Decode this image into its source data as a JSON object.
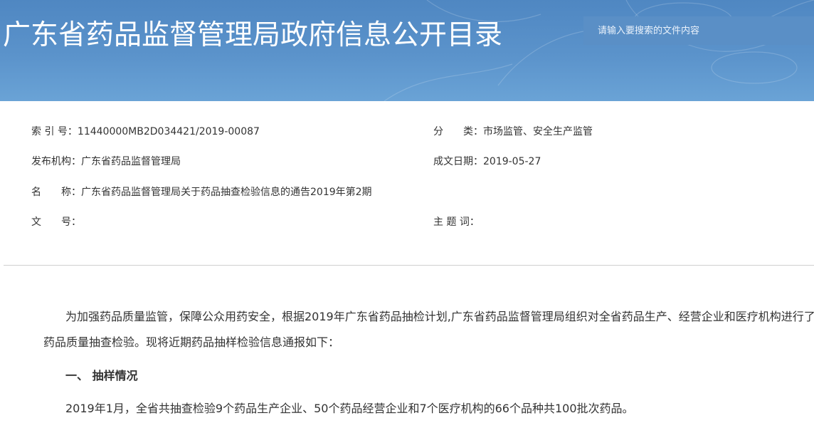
{
  "header": {
    "site_title": "广东省药品监督管理局政府信息公开目录",
    "search_placeholder": "请输入要搜索的文件内容"
  },
  "meta": {
    "index_no": {
      "label": "索 引 号：",
      "value": "11440000MB2D034421/2019-00087"
    },
    "category": {
      "label": "分　　类：",
      "value": "市场监管、安全生产监管"
    },
    "publisher": {
      "label": "发布机构：",
      "value": "广东省药品监督管理局"
    },
    "date": {
      "label": "成文日期：",
      "value": "2019-05-27"
    },
    "name": {
      "label": "名　　称：",
      "value": "广东省药品监督管理局关于药品抽查检验信息的通告2019年第2期"
    },
    "doc_no": {
      "label": "文　　号：",
      "value": ""
    },
    "keywords": {
      "label": "主 题 词：",
      "value": ""
    }
  },
  "body": {
    "intro_line1": "为加强药品质量监管，保障公众用药安全，根据2019年广东省药品抽检计划,广东省药品监督管理局组织对全省药品生产、经营企业和医疗机构进行了",
    "intro_line2": "药品质量抽查检验。现将近期药品抽样检验信息通报如下：",
    "section1_heading": "一、 抽样情况",
    "section1_text": "2019年1月，全省共抽查检验9个药品生产企业、50个药品经营企业和7个医疗机构的66个品种共100批次药品。"
  },
  "colors": {
    "banner": "#5b93cb",
    "search_bg": "#5a8fc6",
    "text": "#333333",
    "divider": "#cfcfcf"
  }
}
